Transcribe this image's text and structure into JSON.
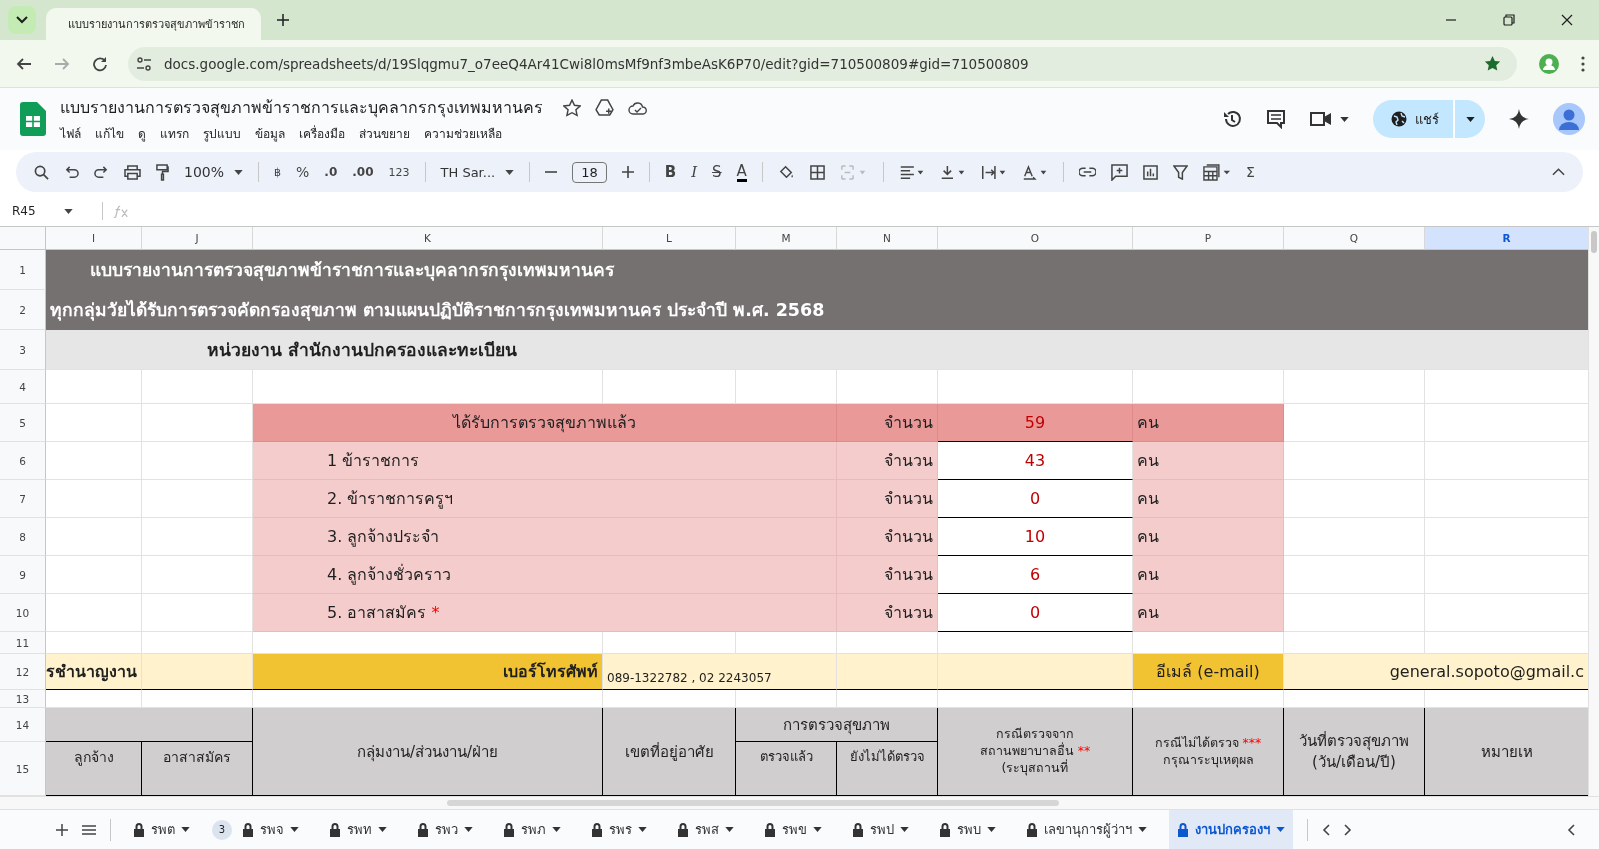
{
  "browser": {
    "tab_title": "แบบรายงานการตรวจสุขภาพข้าราชก",
    "url": "docs.google.com/spreadsheets/d/19Slqgmu7_o7eeQ4Ar41Cwi8l0msMf9nf3mbeAsK6P70/edit?gid=710500809#gid=710500809"
  },
  "doc": {
    "title": "แบบรายงานการตรวจสุขภาพข้าราชการและบุคลากรกรุงเทพมหานคร",
    "menu": [
      "ไฟล์",
      "แก้ไข",
      "ดู",
      "แทรก",
      "รูปแบบ",
      "ข้อมูล",
      "เครื่องมือ",
      "ส่วนขยาย",
      "ความช่วยเหลือ"
    ],
    "share_label": "แชร์"
  },
  "toolbar": {
    "zoom": "100%",
    "currency": "฿",
    "percent": "%",
    "decimal_decrease": ".0",
    "decimal_increase": ".00",
    "number_format": "123",
    "font": "TH Sar...",
    "font_size": "18",
    "sum": "Σ",
    "text_buttons": [
      {
        "glyph": "B",
        "kind": "bold"
      },
      {
        "glyph": "I",
        "kind": "italic"
      },
      {
        "glyph": "S",
        "kind": "strike"
      },
      {
        "glyph": "A",
        "kind": "color"
      }
    ]
  },
  "formula_bar": {
    "cell_ref": "R45"
  },
  "sheet": {
    "columns": [
      {
        "label": "I",
        "selected": false
      },
      {
        "label": "J",
        "selected": false
      },
      {
        "label": "K",
        "selected": false
      },
      {
        "label": "L",
        "selected": false
      },
      {
        "label": "M",
        "selected": false
      },
      {
        "label": "N",
        "selected": false
      },
      {
        "label": "O",
        "selected": false
      },
      {
        "label": "P",
        "selected": false
      },
      {
        "label": "Q",
        "selected": false
      },
      {
        "label": "R",
        "selected": true
      }
    ],
    "rows": [
      "1",
      "2",
      "3",
      "4",
      "5",
      "6",
      "7",
      "8",
      "9",
      "10",
      "11",
      "12",
      "13",
      "14",
      "15"
    ],
    "title_1": "แบบรายงานการตรวจสุขภาพข้าราชการและบุคลากรกรุงเทพมหานคร",
    "title_2": "ทุกกลุ่มวัยได้รับการตรวจคัดกรองสุขภาพ ตามแผนปฏิบัติราชการกรุงเทพมหานคร ประจำปี พ.ศ. 2568",
    "unit_line": "หน่วยงาน สำนักงานปกครองและทะเบียน",
    "summary": {
      "heading": "ได้รับการตรวจสุขภาพแล้ว",
      "count_label": "จำนวน",
      "value": "59",
      "unit": "คน",
      "items": [
        {
          "label": "1 ข้าราชการ",
          "count_label": "จำนวน",
          "value": "43",
          "unit": "คน"
        },
        {
          "label": "2. ข้าราชการครูฯ",
          "count_label": "จำนวน",
          "value": "0",
          "unit": "คน"
        },
        {
          "label": "3. ลูกจ้างประจำ",
          "count_label": "จำนวน",
          "value": "10",
          "unit": "คน"
        },
        {
          "label": "4. ลูกจ้างชั่วคราว",
          "count_label": "จำนวน",
          "value": "6",
          "unit": "คน"
        },
        {
          "label": "5. อาสาสมัคร ",
          "mark": "*",
          "count_label": "จำนวน",
          "value": "0",
          "unit": "คน"
        }
      ]
    },
    "contact": {
      "position_fragment": "รชำนาญงาน",
      "phone_label": "เบอร์โทรศัพท์",
      "phone": "089-1322782 , 02 2243057",
      "email_label": "อีเมล์ (e-mail)",
      "email": "general.sopoto@gmail.c"
    },
    "header": {
      "group": "กลุ่มงาน/ส่วนงาน/ฝ่าย",
      "district": "เขตที่อยู่อาศัย",
      "checkup": "การตรวจสุขภาพ",
      "employee": "ลูกจ้าง",
      "volunteer": "อาสาสมัคร",
      "checked": "ตรวจแล้ว",
      "not_checked": "ยังไม่ได้ตรวจ",
      "other_hospital": [
        {
          "text": "กรณีตรวจจาก"
        },
        {
          "text": "สถานพยาบาลอื่น ",
          "mark": "**"
        },
        {
          "text": "(ระบุสถานที่"
        }
      ],
      "not_examined": [
        {
          "text": "กรณีไม่ได้ตรวจ ",
          "mark": "***"
        },
        {
          "text": "กรุณาระบุเหตุผล"
        }
      ],
      "date": [
        {
          "text": "วันที่ตรวจสุขภาพ"
        },
        {
          "text": "(วัน/เดือน/ปี)"
        }
      ],
      "remark": "หมายเห"
    }
  },
  "sheet_tabs": [
    {
      "label": "รพต",
      "locked": true,
      "selected": false
    },
    {
      "label": "รพจ",
      "locked": true,
      "selected": false,
      "badge": "3"
    },
    {
      "label": "รพท",
      "locked": true,
      "selected": false
    },
    {
      "label": "รพว",
      "locked": true,
      "selected": false
    },
    {
      "label": "รพภ",
      "locked": true,
      "selected": false
    },
    {
      "label": "รพร",
      "locked": true,
      "selected": false
    },
    {
      "label": "รพส",
      "locked": true,
      "selected": false
    },
    {
      "label": "รพข",
      "locked": true,
      "selected": false
    },
    {
      "label": "รพป",
      "locked": true,
      "selected": false
    },
    {
      "label": "รพบ",
      "locked": true,
      "selected": false
    },
    {
      "label": "เลขานุการผู้ว่าฯ",
      "locked": true,
      "selected": false
    },
    {
      "label": "งานปกครองฯ",
      "locked": true,
      "selected": true
    }
  ]
}
